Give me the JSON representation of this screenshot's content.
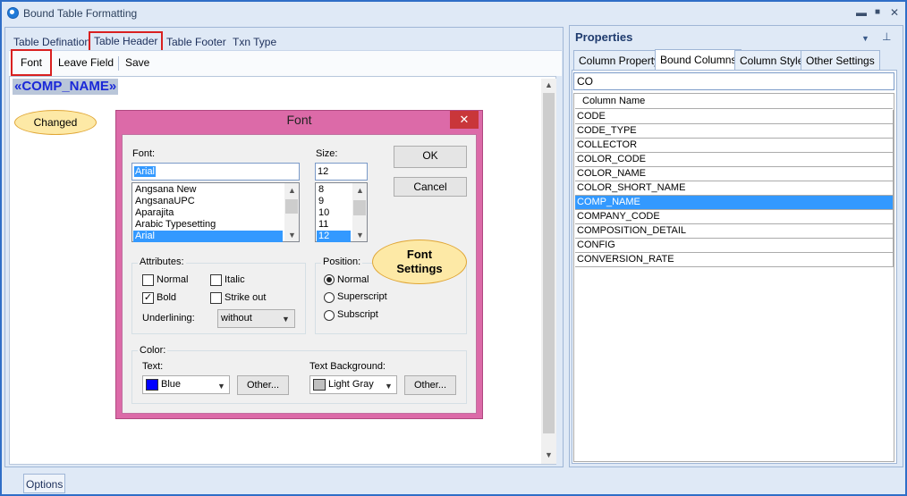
{
  "window": {
    "title": "Bound Table Formatting",
    "minimize": "▬",
    "maximize": "■",
    "close": "✕"
  },
  "left_tabs": [
    "Table Defination",
    "Table Header",
    "Table Footer",
    "Txn Type"
  ],
  "toolbar": {
    "font": "Font",
    "leave_field": "Leave Field",
    "save": "Save"
  },
  "editor": {
    "field_text": "«COMP_NAME»"
  },
  "annotations": {
    "changed": "Changed",
    "font_settings_1": "Font",
    "font_settings_2": "Settings"
  },
  "font_dialog": {
    "title": "Font",
    "close": "✕",
    "font_label": "Font:",
    "font_value": "Arial",
    "font_list": [
      "Angsana New",
      "AngsanaUPC",
      "Aparajita",
      "Arabic Typesetting",
      "Arial"
    ],
    "font_selected_index": 4,
    "size_label": "Size:",
    "size_value": "12",
    "size_list": [
      "8",
      "9",
      "10",
      "11",
      "12"
    ],
    "size_selected_index": 4,
    "ok": "OK",
    "cancel": "Cancel",
    "attributes": {
      "label": "Attributes:",
      "normal": "Normal",
      "italic": "Italic",
      "bold": "Bold",
      "strike_out": "Strike out",
      "underlining_label": "Underlining:",
      "underlining_value": "without",
      "checked_mark": "✓"
    },
    "position": {
      "label": "Position:",
      "normal": "Normal",
      "superscript": "Superscript",
      "subscript": "Subscript"
    },
    "color": {
      "label": "Color:",
      "text_label": "Text:",
      "text_value": "Blue",
      "text_swatch": "#0000ff",
      "text_other": "Other...",
      "bg_label": "Text Background:",
      "bg_value": "Light Gray",
      "bg_swatch": "#c0c0c0",
      "bg_other": "Other..."
    }
  },
  "properties": {
    "title": "Properties",
    "tabs": [
      "Column Property",
      "Bound Columns",
      "Column Style",
      "Other Settings"
    ],
    "active_tab": 1,
    "filter_value": "CO",
    "column_header": "Column Name",
    "columns": [
      "CODE",
      "CODE_TYPE",
      "COLLECTOR",
      "COLOR_CODE",
      "COLOR_NAME",
      "COLOR_SHORT_NAME",
      "COMP_NAME",
      "COMPANY_CODE",
      "COMPOSITION_DETAIL",
      "CONFIG",
      "CONVERSION_RATE"
    ],
    "selected_index": 6
  },
  "bottom": {
    "options": "Options"
  },
  "icons": {
    "pin": "pin-icon",
    "dropdown": "dropdown-icon",
    "app": "app-icon"
  },
  "colors": {
    "accent": "#2f6ec7",
    "selection": "#3399ff",
    "dialog_frame": "#dc6aa8",
    "highlight_box": "#d92020"
  }
}
